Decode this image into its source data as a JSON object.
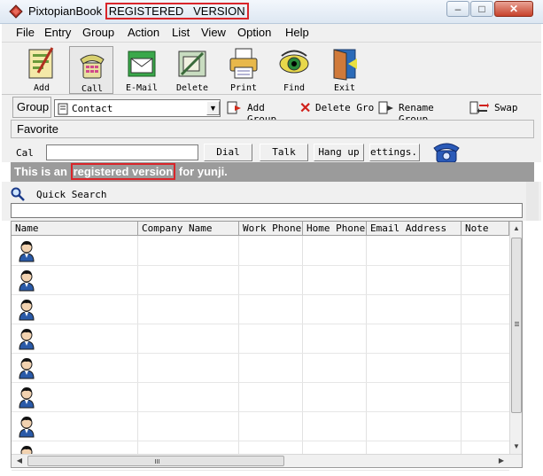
{
  "window": {
    "app_name": "PixtopianBook",
    "registered_tag": "REGISTERED   VERSION",
    "minimize": "–",
    "maximize": "□",
    "close": "✕"
  },
  "menu": [
    "File",
    "Entry",
    "Group",
    "Action",
    "List",
    "View",
    "Option",
    "Help"
  ],
  "toolbar": [
    {
      "label": "Add",
      "icon": "add-contact-icon"
    },
    {
      "label": "Call",
      "icon": "phone-icon"
    },
    {
      "label": "E-Mail",
      "icon": "email-icon"
    },
    {
      "label": "Delete",
      "icon": "delete-icon"
    },
    {
      "label": "Print",
      "icon": "print-icon"
    },
    {
      "label": "Find",
      "icon": "eye-icon"
    },
    {
      "label": "Exit",
      "icon": "exit-door-icon"
    }
  ],
  "group_bar": {
    "group_label": "Group",
    "selected_group": "Contact",
    "add_group": "Add Group",
    "delete_group": "Delete Grou",
    "rename_group": "Rename Group",
    "swap": "Swap"
  },
  "favorite_label": "Favorite",
  "call_bar": {
    "call_label": "Cal",
    "dial": "Dial",
    "talk": "Talk",
    "hang_up": "Hang up",
    "settings": "ettings.."
  },
  "banner": {
    "prefix": "This is an ",
    "highlight": "registered version",
    "suffix": " for yunji."
  },
  "quick_search": {
    "label": "Quick Search",
    "value": ""
  },
  "table": {
    "columns": [
      "Name",
      "Company Name",
      "Work Phone",
      "Home Phone",
      "Email Address",
      "Note"
    ],
    "row_count": 8
  },
  "colors": {
    "highlight_box": "#d9252a",
    "banner_bg": "#9b9b9b"
  }
}
